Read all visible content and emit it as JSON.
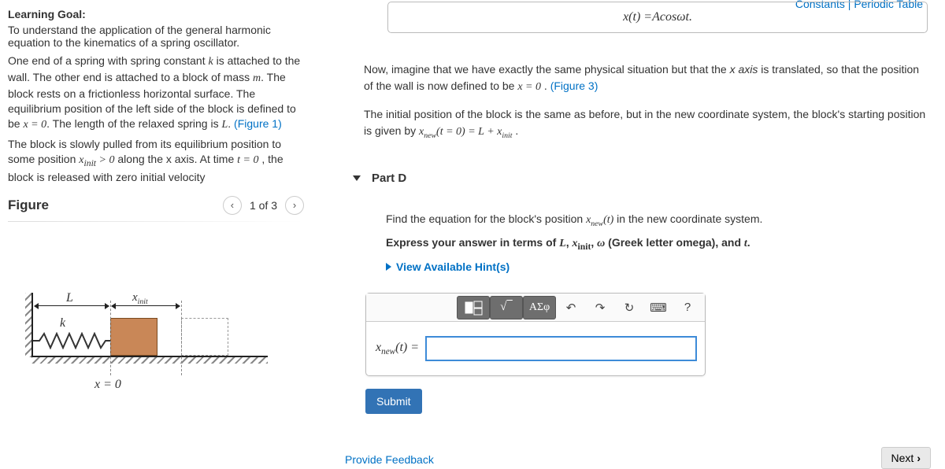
{
  "top_links": {
    "constants": "Constants",
    "periodic": "Periodic Table"
  },
  "learning_goal": {
    "label": "Learning Goal:",
    "text": "To understand the application of the general harmonic equation to the kinematics of a spring oscillator."
  },
  "problem": {
    "p1a": "One end of a spring with spring constant ",
    "k": "k",
    "p1b": " is attached to the wall. The other end is attached to a block of mass ",
    "m": "m",
    "p1c": ". The block rests on a frictionless horizontal surface. The equilibrium position of the left side of the block is defined to be ",
    "eqpos": "x = 0",
    "p1d": ". The length of the relaxed spring is ",
    "L": "L",
    "p1e": ". ",
    "fig1": "(Figure 1)",
    "p2a": "The block is slowly pulled from its equilibrium position to some position ",
    "xinit_gt": "xinit > 0",
    "p2b": " along the x axis. At time ",
    "t0": "t = 0",
    "p2c": " , the block is released with zero initial velocity"
  },
  "figure": {
    "title": "Figure",
    "nav_label": "1 of 3",
    "labels": {
      "L": "L",
      "xinit": "xinit",
      "k": "k",
      "x0": "x = 0"
    }
  },
  "prev_answer": "x(t) = A cos ωt.",
  "instr": {
    "p1a": "Now, imagine that we have exactly the same physical situation but that the ",
    "xaxis": "x axis",
    "p1b": " is translated, so that the position of the wall is now defined to be ",
    "x0": "x = 0",
    "p1c": " . ",
    "fig3": "(Figure 3)",
    "p2a": "The initial position of the block is the same as before, but in the new coordinate system, the block's starting position is given by ",
    "eq": "xnew(t = 0) = L + xinit",
    "p2b": " ."
  },
  "part": {
    "title": "Part D",
    "question_a": "Find the equation for the block's position ",
    "xnewt": "xnew(t)",
    "question_b": " in the new coordinate system.",
    "express_a": "Express your answer in terms of ",
    "express_vars": "L, xinit, ω (Greek letter omega), and t.",
    "hints": "View Available Hint(s)"
  },
  "toolbar": {
    "template": "▭",
    "sqrt": "√▭",
    "greek": "ΑΣφ",
    "undo": "↶",
    "redo": "↷",
    "reset": "↻",
    "keyboard": "⌨",
    "help": "?"
  },
  "answer": {
    "label": "xnew(t) = ",
    "placeholder": ""
  },
  "buttons": {
    "submit": "Submit",
    "next": "Next",
    "feedback": "Provide Feedback"
  }
}
